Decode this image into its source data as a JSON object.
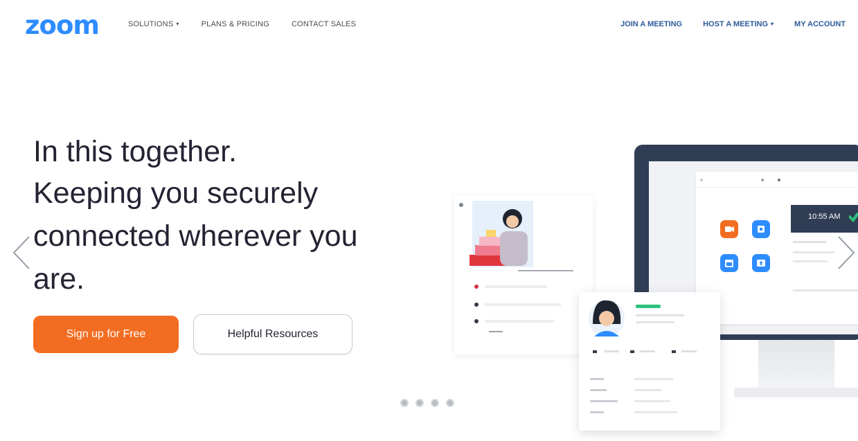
{
  "brand": {
    "logo_text": "zoom",
    "color": "#2D8CFF"
  },
  "nav": {
    "left": [
      {
        "label": "SOLUTIONS",
        "dropdown": true
      },
      {
        "label": "PLANS & PRICING",
        "dropdown": false
      },
      {
        "label": "CONTACT SALES",
        "dropdown": false
      }
    ],
    "right": [
      {
        "label": "JOIN A MEETING",
        "dropdown": false
      },
      {
        "label": "HOST A MEETING",
        "dropdown": true
      },
      {
        "label": "MY ACCOUNT",
        "dropdown": false
      }
    ]
  },
  "hero": {
    "lines": [
      "In this together.",
      "Keeping you securely",
      "connected wherever you",
      "are."
    ],
    "primary_button": "Sign up for Free",
    "secondary_button": "Helpful Resources"
  },
  "carousel": {
    "slide_count": 4,
    "prev_icon": "chevron-left-icon",
    "next_icon": "chevron-right-icon"
  },
  "illustration": {
    "clock_text": "10:55 AM"
  },
  "colors": {
    "accent_orange": "#F26D21",
    "nav_blue": "#2D5B9A",
    "monitor_frame": "#2F3E55"
  }
}
